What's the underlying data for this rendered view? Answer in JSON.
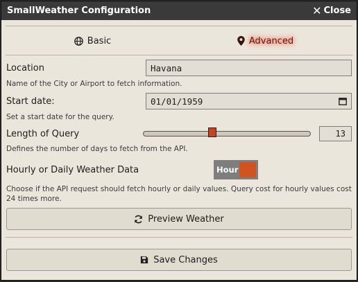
{
  "window": {
    "title": "SmallWeather Configuration",
    "close_label": "Close"
  },
  "tabs": [
    {
      "label": "Basic",
      "icon": "globe-icon",
      "active": false
    },
    {
      "label": "Advanced",
      "icon": "map-marker-icon",
      "active": true
    }
  ],
  "location": {
    "label": "Location",
    "value": "Havana",
    "hint": "Name of the City or Airport to fetch information."
  },
  "start_date": {
    "label": "Start date:",
    "value": "01/01/1959",
    "hint": "Set a start date for the query."
  },
  "length": {
    "label": "Length of Query",
    "value": "13",
    "hint": "Defines the number of days to fetch from the API."
  },
  "hourly": {
    "label": "Hourly or Daily Weather Data",
    "toggle_text": "Hour",
    "hint": "Choose if the API request should fetch hourly or daily values. Query cost for hourly values cost 24 times more."
  },
  "buttons": {
    "preview": "Preview Weather",
    "save": "Save Changes"
  },
  "colors": {
    "accent": "#d1531f",
    "titlebar": "#3a3a3a",
    "background": "#ebe6dc",
    "active_tab_glow": "#ff4d33"
  }
}
